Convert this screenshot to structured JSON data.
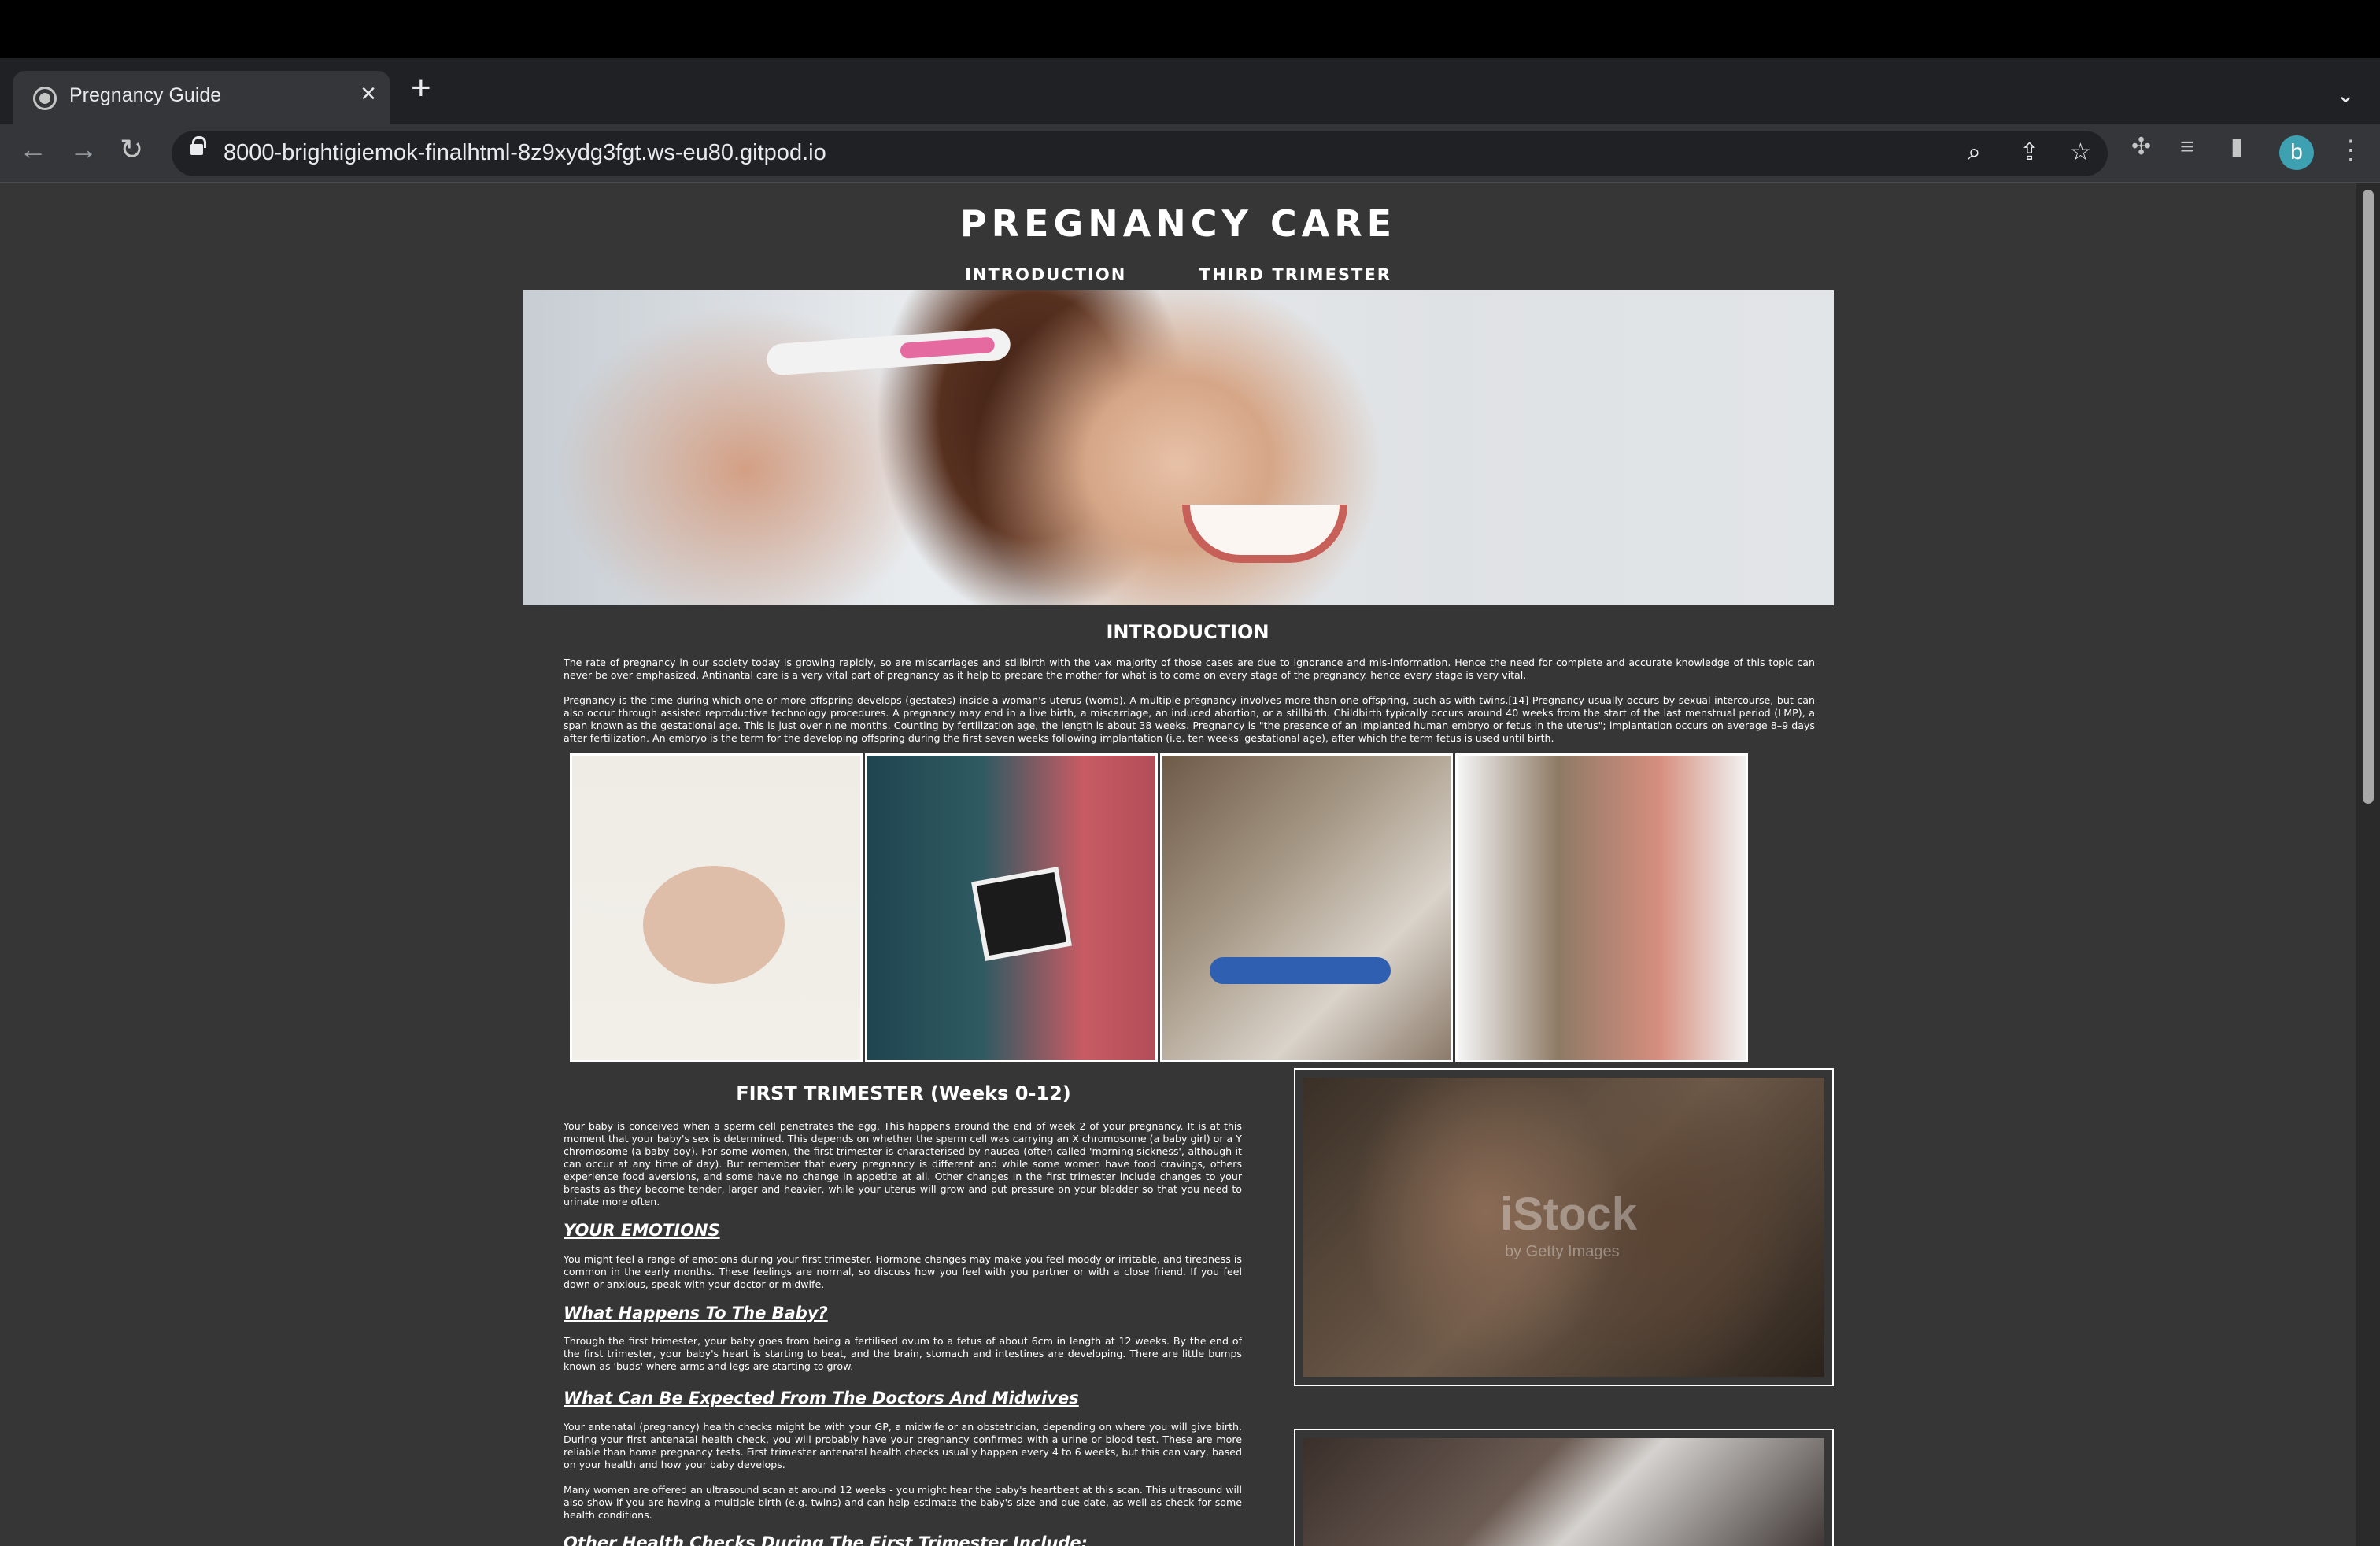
{
  "browser": {
    "tab_title": "Pregnancy Guide",
    "url": "8000-brightigiemok-finalhtml-8z9xydg3fgt.ws-eu80.gitpod.io",
    "profile_initial": "b"
  },
  "page": {
    "title": "PREGNANCY CARE",
    "nav": [
      "INTRODUCTION",
      "THIRD TRIMESTER"
    ],
    "intro": {
      "heading": "INTRODUCTION",
      "paragraphs": [
        "The rate of pregnancy in our society today is growing rapidly, so are miscarriages and stillbirth with the vax majority of those cases are due to ignorance and mis-information. Hence the need for complete and accurate knowledge of this topic can never be over emphasized. Antinantal care is a very vital part of pregnancy as it help to prepare the mother for what is to come on every stage of the pregnancy. hence every stage is very vital.",
        "Pregnancy is the time during which one or more offspring develops (gestates) inside a woman's uterus (womb). A multiple pregnancy involves more than one offspring, such as with twins.[14] Pregnancy usually occurs by sexual intercourse, but can also occur through assisted reproductive technology procedures. A pregnancy may end in a live birth, a miscarriage, an induced abortion, or a stillbirth. Childbirth typically occurs around 40 weeks from the start of the last menstrual period (LMP), a span known as the gestational age. This is just over nine months. Counting by fertilization age, the length is about 38 weeks. Pregnancy is \"the presence of an implanted human embryo or fetus in the uterus\"; implantation occurs on average 8–9 days after fertilization. An embryo is the term for the developing offspring during the first seven weeks following implantation (i.e. ten weeks' gestational age), after which the term fetus is used until birth."
      ]
    },
    "first_trimester": {
      "heading": "FIRST TRIMESTER (Weeks 0-12)",
      "paragraph": "Your baby is conceived when a sperm cell penetrates the egg. This happens around the end of week 2 of your pregnancy. It is at this moment that your baby's sex is determined. This depends on whether the sperm cell was carrying an X chromosome (a baby girl) or a Y chromosome (a baby boy). For some women, the first trimester is characterised by nausea (often called 'morning sickness', although it can occur at any time of day). But remember that every pregnancy is different and while some women have food cravings, others experience food aversions, and some have no change in appetite at all. Other changes in the first trimester include changes to your breasts as they become tender, larger and heavier, while your uterus will grow and put pressure on your bladder so that you need to urinate more often.",
      "emotions_heading": "YOUR EMOTIONS",
      "emotions_text": "You might feel a range of emotions during your first trimester. Hormone changes may make you feel moody or irritable, and tiredness is common in the early months. These feelings are normal, so discuss how you feel with you partner or with a close friend. If you feel down or anxious, speak with your doctor or midwife.",
      "baby_heading": "What Happens To The Baby?",
      "baby_text": "Through the first trimester, your baby goes from being a fertilised ovum to a fetus of about 6cm in length at 12 weeks. By the end of the first trimester, your baby's heart is starting to beat, and the brain, stomach and intestines are developing. There are little bumps known as 'buds' where arms and legs are starting to grow.",
      "doctors_heading": "What Can Be Expected From The Doctors And Midwives",
      "doctors_text_1": "Your antenatal (pregnancy) health checks might be with your GP, a midwife or an obstetrician, depending on where you will give birth. During your first antenatal health check, you will probably have your pregnancy confirmed with a urine or blood test. These are more reliable than home pregnancy tests. First trimester antenatal health checks usually happen every 4 to 6 weeks, but this can vary, based on your health and how your baby develops.",
      "doctors_text_2": "Many women are offered an ultrasound scan at around 12 weeks - you might hear the baby's heartbeat at this scan. This ultrasound will also show if you are having a multiple birth (e.g. twins) and can help estimate the baby's size and due date, as well as check for some health conditions.",
      "other_checks_heading": "Other Health Checks During The First Trimester Include:"
    },
    "watermark": {
      "brand": "iStock",
      "sub": "by Getty Images"
    }
  }
}
